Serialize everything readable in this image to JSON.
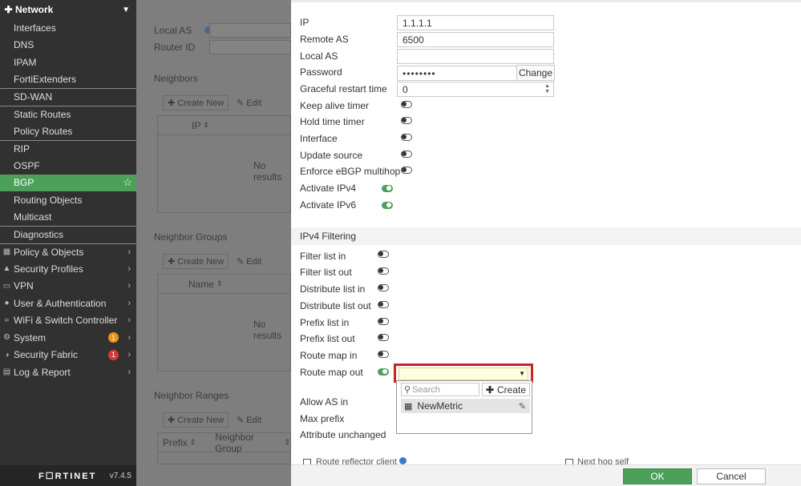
{
  "sidebar": {
    "network": {
      "label": "Network"
    },
    "network_items": [
      "Interfaces",
      "DNS",
      "IPAM",
      "FortiExtenders",
      "SD-WAN",
      "Static Routes",
      "Policy Routes",
      "RIP",
      "OSPF",
      "BGP",
      "Routing Objects",
      "Multicast",
      "Diagnostics"
    ],
    "top_items": [
      {
        "label": "Policy & Objects"
      },
      {
        "label": "Security Profiles"
      },
      {
        "label": "VPN"
      },
      {
        "label": "User & Authentication"
      },
      {
        "label": "WiFi & Switch Controller"
      },
      {
        "label": "System",
        "badge": "1"
      },
      {
        "label": "Security Fabric",
        "badge": "1"
      },
      {
        "label": "Log & Report"
      }
    ],
    "logo": "F☐RTINET",
    "version": "v7.4.5"
  },
  "background": {
    "local_as": "Local AS",
    "router_id": "Router ID",
    "neighbors": "Neighbors",
    "neighbor_groups": "Neighbor Groups",
    "neighbor_ranges": "Neighbor Ranges",
    "create_new": "Create New",
    "edit": "Edit",
    "col_ip": "IP",
    "col_name": "Name",
    "col_prefix": "Prefix",
    "col_neighbor_group": "Neighbor Group",
    "no_results": "No results"
  },
  "form": {
    "ip_label": "IP",
    "ip_value": "1.1.1.1",
    "remote_as_label": "Remote AS",
    "remote_as_value": "6500",
    "local_as_label": "Local AS",
    "local_as_value": "",
    "password_label": "Password",
    "password_value": "••••••••",
    "change_label": "Change",
    "graceful_label": "Graceful restart time",
    "graceful_value": "0",
    "keepalive_label": "Keep alive timer",
    "hold_label": "Hold time timer",
    "interface_label": "Interface",
    "update_source_label": "Update source",
    "ebgp_label": "Enforce eBGP multihop",
    "ipv4_label": "Activate IPv4",
    "ipv6_label": "Activate IPv6"
  },
  "filtering": {
    "title": "IPv4 Filtering",
    "filter_in": "Filter list in",
    "filter_out": "Filter list out",
    "distribute_in": "Distribute list in",
    "distribute_out": "Distribute list out",
    "prefix_in": "Prefix list in",
    "prefix_out": "Prefix list out",
    "route_map_in": "Route map in",
    "route_map_out": "Route map out",
    "allow_as_in": "Allow AS in",
    "max_prefix": "Max prefix",
    "attr_unchanged": "Attribute unchanged",
    "route_reflector": "Route reflector client",
    "next_hop_self": "Next hop self"
  },
  "dropdown": {
    "search_placeholder": "Search",
    "create_label": "Create",
    "item": "NewMetric"
  },
  "footer": {
    "ok": "OK",
    "cancel": "Cancel"
  }
}
